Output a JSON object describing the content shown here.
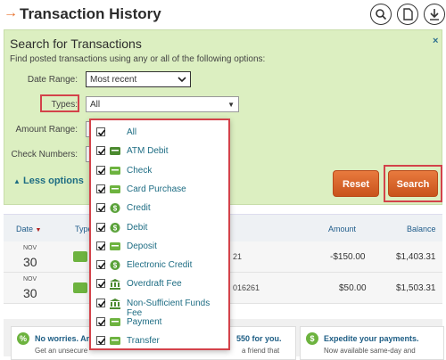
{
  "header": {
    "title": "Transaction History",
    "icons": [
      "search-icon",
      "document-icon",
      "download-icon"
    ]
  },
  "search": {
    "title": "Search for Transactions",
    "subtitle": "Find posted transactions using any or all of the following options:",
    "close": "×",
    "date_range_label": "Date Range:",
    "date_range_value": "Most recent",
    "types_label": "Types:",
    "types_value": "All",
    "amount_range_label": "Amount Range:",
    "check_numbers_label": "Check Numbers:",
    "less_options": "Less options",
    "reset": "Reset",
    "search": "Search"
  },
  "types_dropdown": [
    {
      "label": "All",
      "icon": "none"
    },
    {
      "label": "ATM Debit",
      "icon": "atm-icon"
    },
    {
      "label": "Check",
      "icon": "check-icon"
    },
    {
      "label": "Card Purchase",
      "icon": "card-icon"
    },
    {
      "label": "Credit",
      "icon": "credit-icon"
    },
    {
      "label": "Debit",
      "icon": "debit-icon"
    },
    {
      "label": "Deposit",
      "icon": "deposit-icon"
    },
    {
      "label": "Electronic Credit",
      "icon": "electronic-credit-icon"
    },
    {
      "label": "Overdraft Fee",
      "icon": "bank-icon"
    },
    {
      "label": "Non-Sufficient Funds Fee",
      "icon": "bank-icon"
    },
    {
      "label": "Payment",
      "icon": "payment-icon"
    },
    {
      "label": "Transfer",
      "icon": "transfer-icon"
    }
  ],
  "table": {
    "headers": {
      "date": "Date",
      "type": "Type",
      "amount": "Amount",
      "balance": "Balance"
    },
    "rows": [
      {
        "month": "NOV",
        "day": "30",
        "desc": "21",
        "amount": "-$150.00",
        "balance": "$1,403.31"
      },
      {
        "month": "NOV",
        "day": "30",
        "desc": "016261",
        "amount": "$50.00",
        "balance": "$1,503.31"
      }
    ]
  },
  "promo": {
    "left_title": "No worries. An",
    "left_title2": "550 for you.",
    "left_sub": "Get an unsecure",
    "left_sub2": "a friend that",
    "right_title": "Expedite your payments.",
    "right_sub": "Now available same-day and"
  },
  "colors": {
    "accent": "#e8702a",
    "panel_bg": "#dcefc1",
    "highlight": "#d3424a",
    "link": "#1d6c83"
  }
}
